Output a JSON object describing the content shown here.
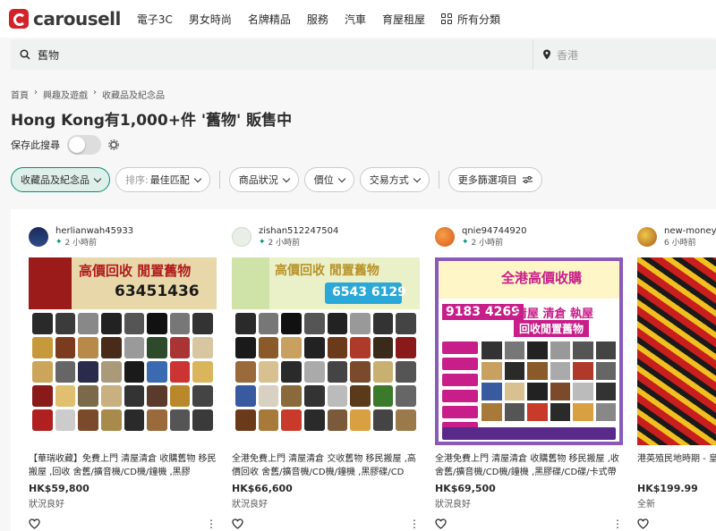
{
  "brand": {
    "name": "carousell",
    "color": "#d2232a"
  },
  "nav": [
    "電子3C",
    "男女時尚",
    "名牌精品",
    "服務",
    "汽車",
    "育屋租屋"
  ],
  "nav_all": "所有分類",
  "search": {
    "query": "舊物",
    "location_placeholder": "香港"
  },
  "breadcrumb": [
    "首頁",
    "興趣及遊戲",
    "收藏品及紀念品"
  ],
  "title": "Hong Kong有1,000+件 '舊物' 販售中",
  "save_search": "保存此搜尋",
  "filters": {
    "category": "收藏品及紀念品",
    "sort_label": "排序:",
    "sort_value": "最佳匹配",
    "condition": "商品狀況",
    "price": "價位",
    "deal": "交易方式",
    "more": "更多篩選項目"
  },
  "accent": "#008f79",
  "listings": [
    {
      "seller": "herlianwah45933",
      "time": "2 小時前",
      "ad_title": "高價回收 閒置舊物",
      "ad_phone": "63451436",
      "desc": "【華瑞收藏】免費上門 清屋清倉 收購舊物 移民搬屋 ,回收 舍舊/擴音機/CD機/鐘機 ,黑膠碟/C...",
      "price": "HK$59,800",
      "condition": "狀況良好"
    },
    {
      "seller": "zishan512247504",
      "time": "2 小時前",
      "ad_title": "高價回收 閒置舊物",
      "ad_phone": "6543 6129",
      "desc": "全港免費上門 清屋清倉 交收舊物 移民搬屋 ,高價回收 舍舊/擴音機/CD機/鐘機 ,黑膠碟/CD碟/...",
      "price": "HK$66,600",
      "condition": "狀況良好"
    },
    {
      "seller": "qnie94744920",
      "time": "2 小時前",
      "ad_title": "全港高價收購",
      "ad_phone": "9183 4269",
      "ad_sub": "清屋 清倉 執屋",
      "ad_sub2": "回收閒置舊物",
      "desc": "全港免費上門 清屋清倉 收購舊物 移民搬屋 ,收舍舊/擴音機/CD機/鐘機 ,黑膠碟/CD碟/卡式帶 ...",
      "price": "HK$69,500",
      "condition": "狀況良好"
    },
    {
      "seller": "new-moneym",
      "time": "6 小時前",
      "desc": "港英殖民地時期 - 皇 梧葉風箭雙繫絲質裝",
      "price": "HK$199.99",
      "condition": "全新"
    }
  ]
}
